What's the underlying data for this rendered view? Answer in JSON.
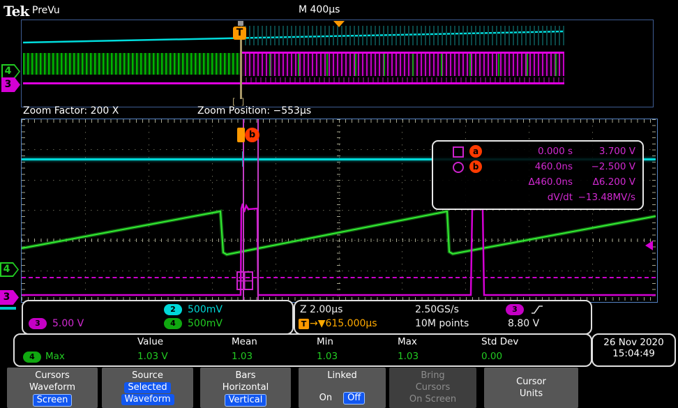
{
  "header": {
    "logo": "Tek",
    "mode": "PreVu",
    "timebase": "M 400µs"
  },
  "overview": {
    "trigger_label": "T",
    "bracket": "[ ]",
    "ch4_label": "4",
    "ch3_label": "3"
  },
  "zoom_bar": {
    "factor": "Zoom Factor: 200 X",
    "position": "Zoom Position: −553µs"
  },
  "main_view": {
    "ch4_label": "4",
    "ch3_label": "3",
    "cursor_b_label": "b"
  },
  "cursor_readout": {
    "a_label": "a",
    "b_label": "b",
    "rows": [
      {
        "time": "0.000 s",
        "volt": "3.700 V"
      },
      {
        "time": "460.0ns",
        "volt": "−2.500 V"
      },
      {
        "time": "Δ460.0ns",
        "volt": "Δ6.200 V"
      },
      {
        "time": "dV/dt",
        "volt": "−13.48MV/s"
      }
    ]
  },
  "channels": {
    "ch2": {
      "num": "2",
      "scale": "500mV"
    },
    "ch3": {
      "num": "3",
      "scale": "5.00 V"
    },
    "ch4": {
      "num": "4",
      "scale": "500mV"
    }
  },
  "horizontal": {
    "zoom_scale": "Z 2.00µs",
    "sample_rate": "2.50GS/s",
    "trig_source": "3",
    "t_label": "T",
    "trig_position": "→▼615.000µs",
    "record_length": "10M points",
    "trig_level": "8.80 V"
  },
  "measurements": {
    "headers": [
      "Value",
      "Mean",
      "Min",
      "Max",
      "Std Dev"
    ],
    "row": {
      "ch": "4",
      "name": "Max",
      "values": [
        "1.03 V",
        "1.03",
        "1.03",
        "1.03",
        "0.00"
      ]
    }
  },
  "datetime": {
    "date": "26 Nov 2020",
    "time": "15:04:49"
  },
  "menu": {
    "cursors": {
      "l1": "Cursors",
      "l2": "Waveform",
      "chip": "Screen"
    },
    "source": {
      "l1": "Source",
      "c1": "Selected",
      "c2": "Waveform"
    },
    "bars": {
      "l1": "Bars",
      "l2": "Horizontal",
      "chip": "Vertical"
    },
    "linked": {
      "l1": "Linked",
      "on": "On",
      "off": "Off"
    },
    "bring": {
      "l1": "Bring",
      "l2": "Cursors",
      "l3": "On Screen"
    },
    "units": {
      "l1": "Cursor",
      "l2": "Units"
    }
  },
  "colors": {
    "ch2_cyan": "#00d8d8",
    "ch3_magenta": "#d400d4",
    "ch4_green": "#22cc22",
    "trigger_orange": "#ff9900",
    "cursor_badge_red": "#ff3a00",
    "menu_highlight_blue": "#1257f0",
    "graticule": "#a8a890"
  }
}
